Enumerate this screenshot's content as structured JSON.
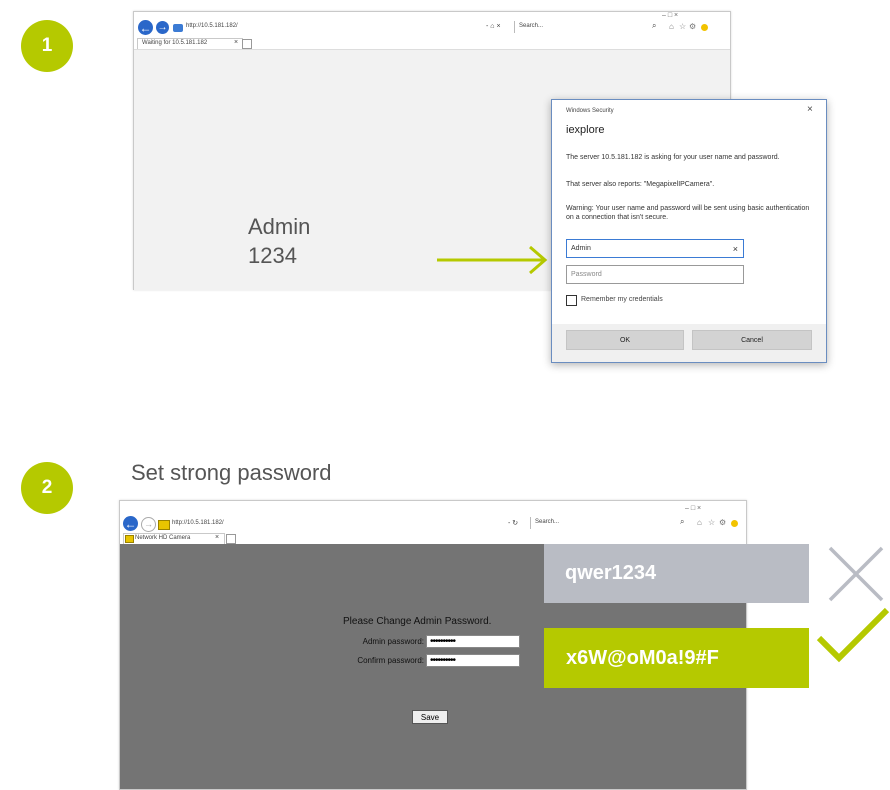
{
  "step1": {
    "number": "1",
    "browser": {
      "url": "http://10.5.181.182/",
      "tab_title": "Waiting for 10.5.181.182",
      "search_placeholder": "Search...",
      "addr_controls": "- ⌂ ×",
      "search_icon": "magnifier-icon",
      "window_controls": "–  □  ×"
    },
    "credentials": {
      "username": "Admin",
      "password": "1234"
    },
    "dialog": {
      "window_title": "Windows Security",
      "app_name": "iexplore",
      "message": "The server 10.5.181.182 is asking for your user name and password.",
      "realm_text": "That server also reports: \"MegapixelIPCamera\".",
      "warning": "Warning: Your user name and password will be sent using basic authentication on a connection that isn't secure.",
      "username_value": "Admin",
      "password_placeholder": "Password",
      "remember_label": "Remember my credentials",
      "ok_label": "OK",
      "cancel_label": "Cancel",
      "close_symbol": "×",
      "clear_symbol": "×"
    }
  },
  "step2": {
    "number": "2",
    "heading": "Set strong password",
    "browser": {
      "url": "http://10.5.181.182/",
      "tab_title": "Network HD Camera",
      "search_placeholder": "Search...",
      "addr_controls": "- ↻",
      "window_controls": "–  □  ×"
    },
    "form": {
      "title": "Please Change Admin Password.",
      "admin_label": "Admin password:",
      "admin_value": "••••••••••",
      "confirm_label": "Confirm password:",
      "confirm_value": "••••••••••",
      "save_label": "Save"
    },
    "weak_password": "qwer1234",
    "strong_password": "x6W@oM0a!9#F"
  },
  "colors": {
    "accent": "#b5c900",
    "weak_bg": "#b9bcc4",
    "strong_bg": "#b5c900",
    "page_gray": "#747474",
    "cross": "#b9bcc4"
  },
  "icons": {
    "back": "back-arrow-icon",
    "forward": "forward-arrow-icon",
    "home": "home-icon",
    "favorites": "star-icon",
    "settings": "gear-icon",
    "smiley": "smiley-icon",
    "cross": "cross-icon",
    "check": "checkmark-icon",
    "pointer": "arrow-pointer-icon"
  }
}
